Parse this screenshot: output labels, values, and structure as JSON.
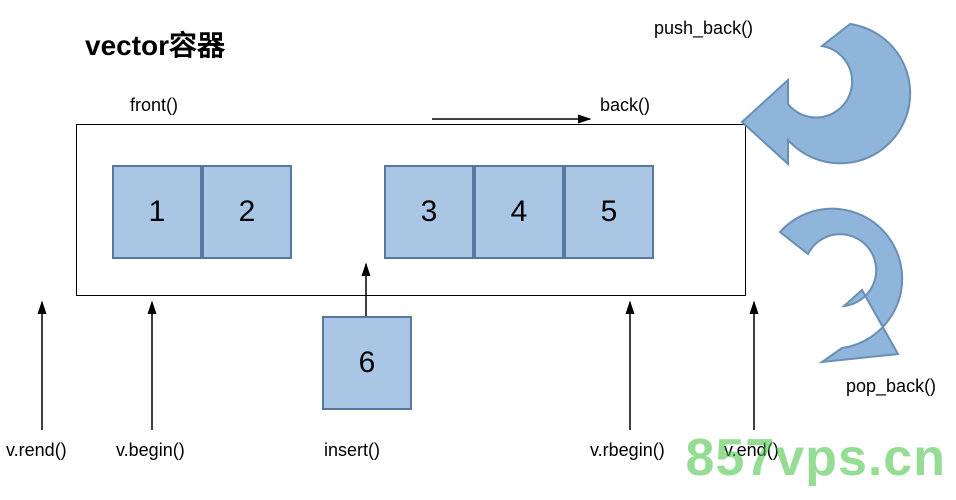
{
  "title": "vector容器",
  "cells": {
    "c1": "1",
    "c2": "2",
    "c3": "3",
    "c4": "4",
    "c5": "5",
    "insert_cell": "6"
  },
  "labels": {
    "push_back": "push_back()",
    "pop_back": "pop_back()",
    "front": "front()",
    "back": "back()",
    "rend": "v.rend()",
    "begin": "v.begin()",
    "insert": "insert()",
    "rbegin": "v.rbegin()",
    "end": "v.end()"
  },
  "watermark": "857vps.cn",
  "colors": {
    "cell_fill": "#a9c7e4",
    "cell_border": "#5978a0",
    "arrow_fill": "#8fb5db",
    "arrow_border": "#6a8fb4",
    "watermark": "#3fc23f"
  }
}
